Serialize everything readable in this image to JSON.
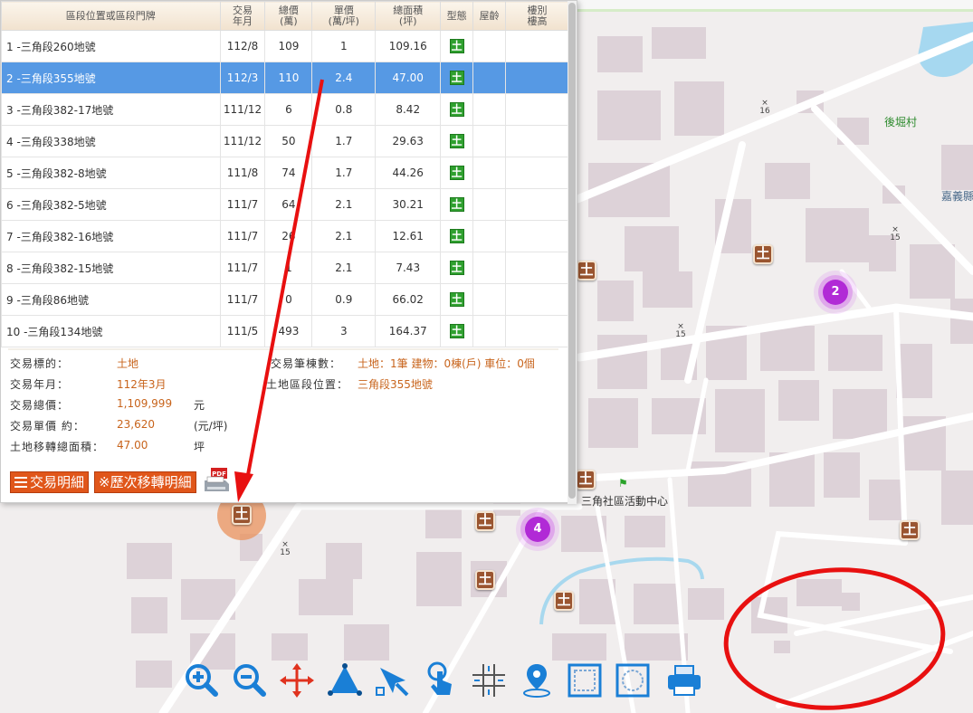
{
  "table": {
    "headers": {
      "location": "區段位置或區段門牌",
      "trade_ym_1": "交易",
      "trade_ym_2": "年月",
      "total_1": "總價",
      "total_2": "(萬)",
      "unit_1": "單價",
      "unit_2": "(萬/坪)",
      "area_1": "總面積",
      "area_2": "(坪)",
      "type": "型態",
      "age": "屋齡",
      "floor_1": "樓別",
      "floor_2": "樓高"
    },
    "rows": [
      {
        "loc": "1 -三角段260地號",
        "ym": "112/8",
        "total": "109",
        "unit": "1",
        "area": "109.16",
        "type": "土"
      },
      {
        "loc": "2 -三角段355地號",
        "ym": "112/3",
        "total": "110",
        "unit": "2.4",
        "area": "47.00",
        "type": "土"
      },
      {
        "loc": "3 -三角段382-17地號",
        "ym": "111/12",
        "total": "6",
        "unit": "0.8",
        "area": "8.42",
        "type": "土"
      },
      {
        "loc": "4 -三角段338地號",
        "ym": "111/12",
        "total": "50",
        "unit": "1.7",
        "area": "29.63",
        "type": "土"
      },
      {
        "loc": "5 -三角段382-8地號",
        "ym": "111/8",
        "total": "74",
        "unit": "1.7",
        "area": "44.26",
        "type": "土"
      },
      {
        "loc": "6 -三角段382-5地號",
        "ym": "111/7",
        "total": "64",
        "unit": "2.1",
        "area": "30.21",
        "type": "土"
      },
      {
        "loc": "7 -三角段382-16地號",
        "ym": "111/7",
        "total": "26",
        "unit": "2.1",
        "area": "12.61",
        "type": "土"
      },
      {
        "loc": "8 -三角段382-15地號",
        "ym": "111/7",
        "total": "1",
        "unit": "2.1",
        "area": "7.43",
        "type": "土"
      },
      {
        "loc": "9 -三角段86地號",
        "ym": "111/7",
        "total": "0",
        "unit": "0.9",
        "area": "66.02",
        "type": "土"
      },
      {
        "loc": "10 -三角段134地號",
        "ym": "111/5",
        "total": "493",
        "unit": "3",
        "area": "164.37",
        "type": "土"
      }
    ],
    "selected_index": 1
  },
  "detail": {
    "subject_label": "交易標的：",
    "subject_value": "土地",
    "ym_label": "交易年月：",
    "ym_value": "112年3月",
    "total_label": "交易總價：",
    "total_value": "1,109,999",
    "total_unit": "元",
    "unit_label": "交易單價 約：",
    "unit_value": "23,620",
    "unit_unit": "(元/坪)",
    "area_label": "土地移轉總面積：",
    "area_value": "47.00",
    "area_unit": "坪",
    "count_label": "交易筆棟數：",
    "count_value": "土地：1筆 建物：0棟(戶) 車位：0個",
    "position_label": "土地區段位置：",
    "position_value": "三角段355地號"
  },
  "buttons": {
    "trade_detail": "交易明細",
    "history_detail": "※歷次移轉明細",
    "pdf_badge": "PDF"
  },
  "map": {
    "village_label": "後堀村",
    "town_label_partial": "嘉義縣",
    "community_center": "三角社區活動中心",
    "road_16": "16",
    "road_15a": "15",
    "road_15b": "15",
    "road_15c": "15",
    "cluster_a": "2",
    "cluster_b": "4",
    "marker_text": "土"
  },
  "toolbar": {
    "icons": [
      "zoom-in-icon",
      "zoom-out-icon",
      "pan-icon",
      "measure-area-icon",
      "select-arrow-icon",
      "touch-query-icon",
      "road-query-icon",
      "location-pin-icon",
      "frame-square-icon",
      "frame-circle-icon",
      "print-icon"
    ]
  },
  "colors": {
    "selected_row": "#5699e4",
    "value_orange": "#c8641c",
    "button_orange": "#e0561a",
    "land_marker": "#9a5530",
    "cluster_purple": "#b12ad6",
    "annotation_red": "#e81010"
  }
}
